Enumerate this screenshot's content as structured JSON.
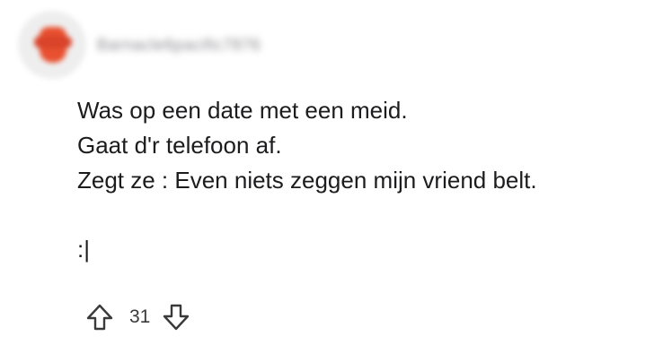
{
  "comment": {
    "username": "Barnacle6pacific7876",
    "lines": [
      "Was op een date met een meid.",
      "Gaat d'r telefoon af.",
      "Zegt ze : Even niets zeggen mijn vriend belt."
    ],
    "trailing": ":|",
    "score": "31"
  },
  "icons": {
    "upvote": "upvote-arrow-icon",
    "downvote": "downvote-arrow-icon"
  },
  "colors": {
    "avatar_accent": "#e8502f",
    "text": "#1c1c1e",
    "muted": "#8a8a8f"
  }
}
